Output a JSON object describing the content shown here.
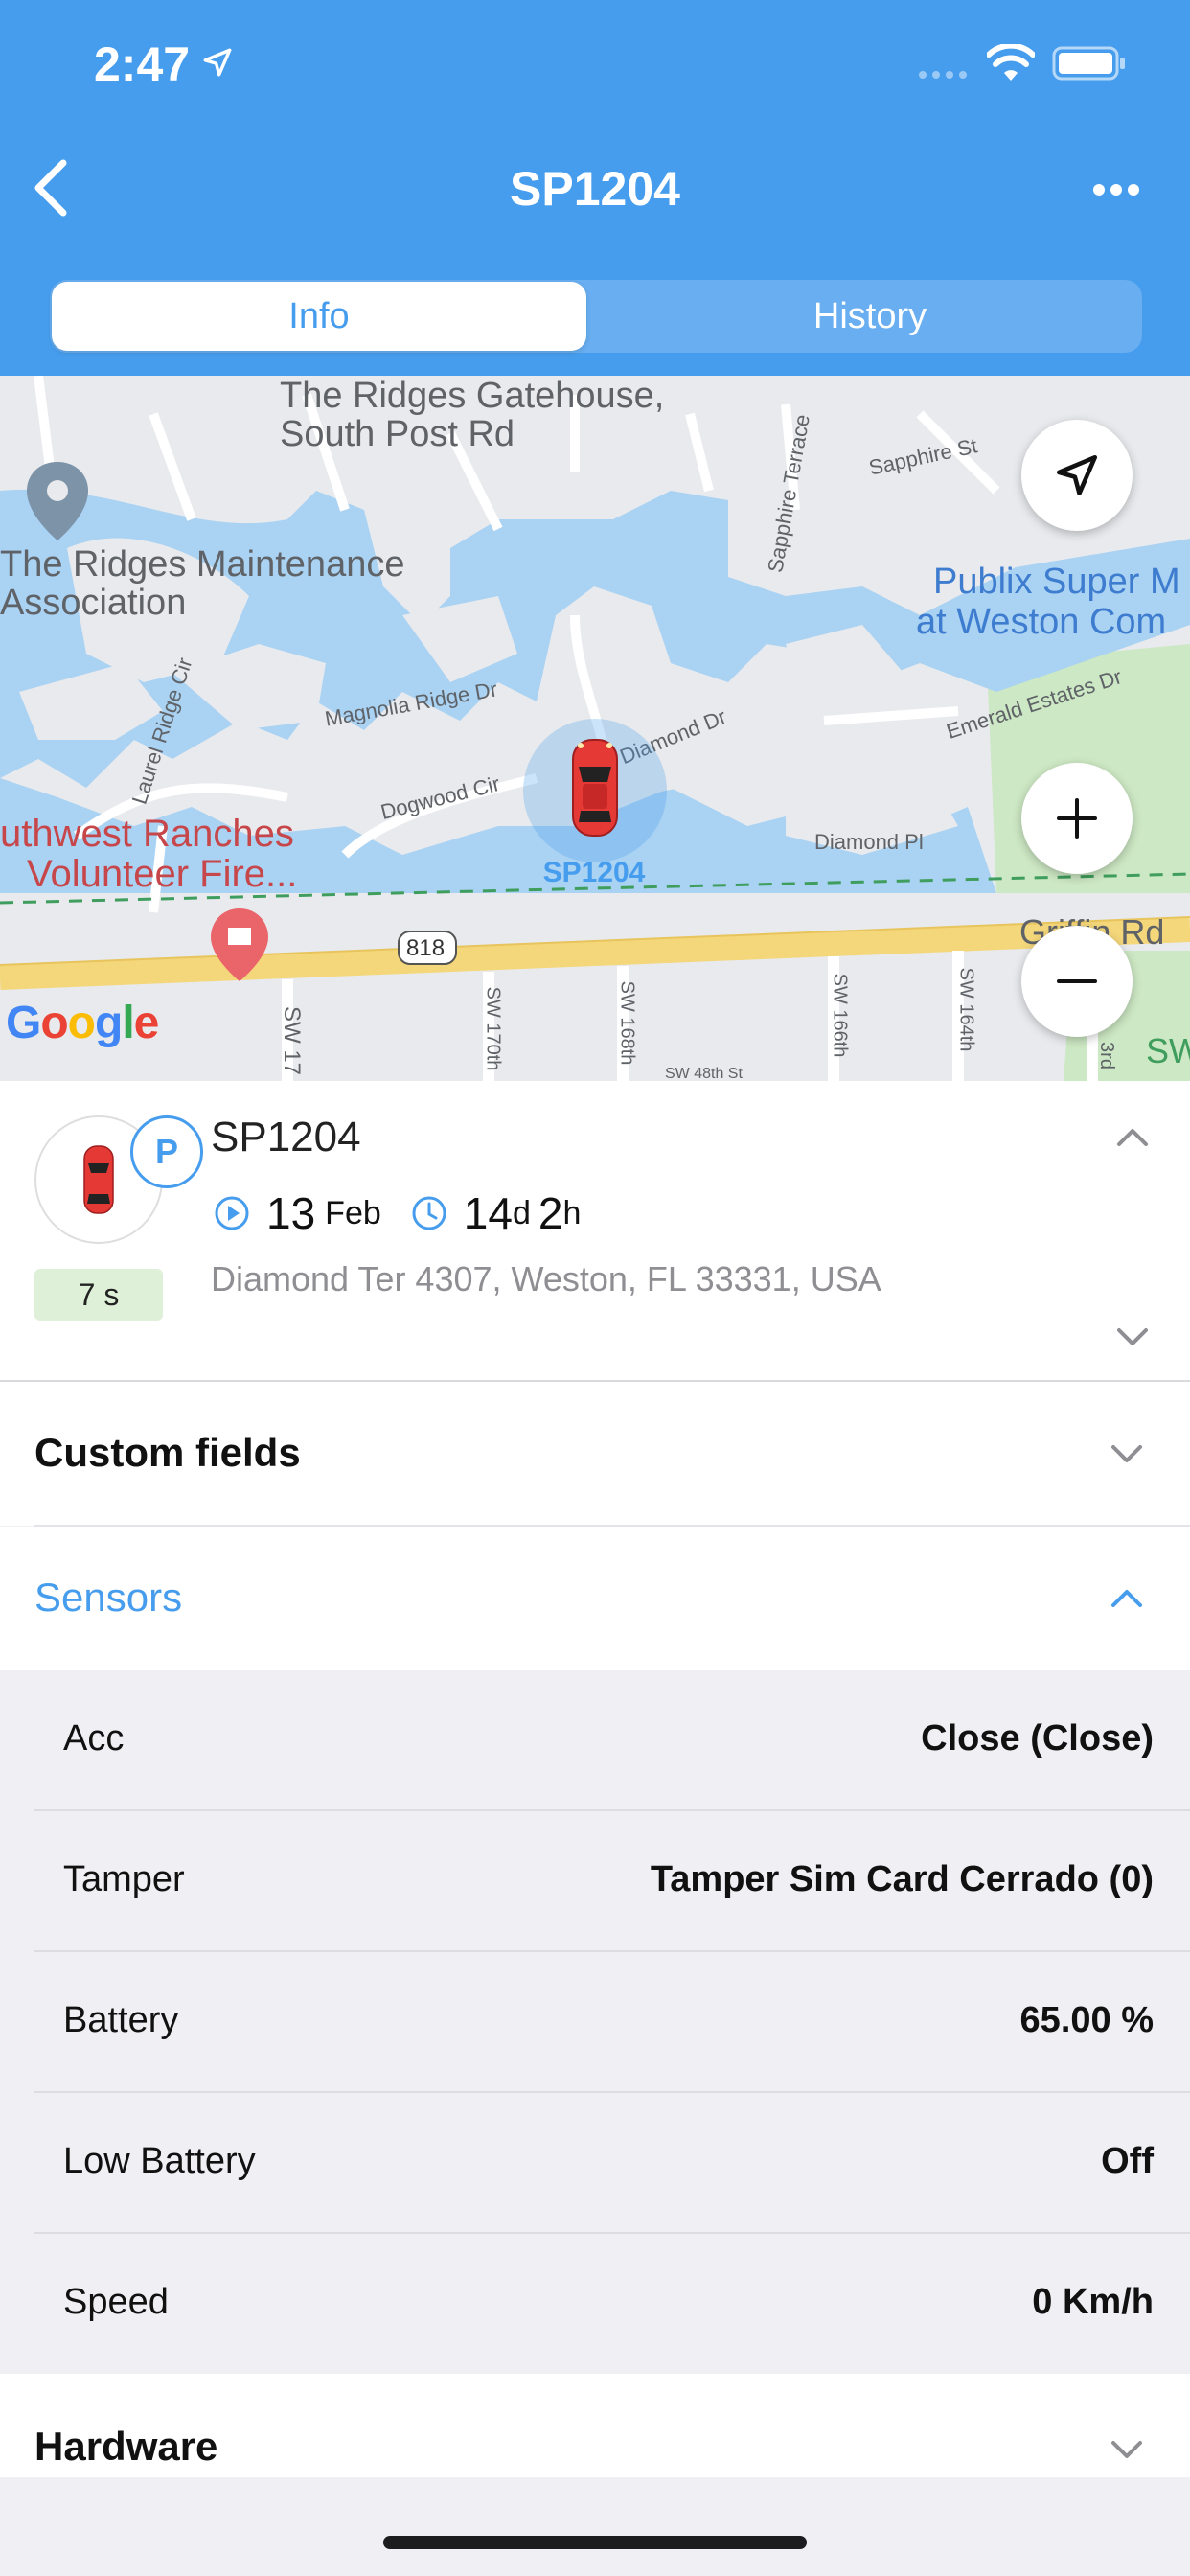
{
  "status_bar": {
    "time": "2:47"
  },
  "nav": {
    "title": "SP1204",
    "tabs": [
      {
        "label": "Info",
        "active": true
      },
      {
        "label": "History",
        "active": false
      }
    ]
  },
  "map": {
    "labels": {
      "gatehouse_1": "The Ridges Gatehouse,",
      "gatehouse_2": "South Post Rd",
      "maint_1": "The Ridges Maintenance",
      "maint_2": "Association",
      "publix_1": "Publix Super M",
      "publix_2": "at Weston Com",
      "fire_1": "uthwest Ranches",
      "fire_2": "Volunteer Fire...",
      "sapphire_st": "Sapphire St",
      "sapphire_terrace": "Sapphire Terrace",
      "magnolia": "Magnolia Ridge Dr",
      "laurel": "Laurel Ridge Cir",
      "dogwood": "Dogwood Cir",
      "diamond_dr": "Diamond Dr",
      "diamond_pl": "Diamond Pl",
      "emerald": "Emerald Estates Dr",
      "griffin": "Griffin Rd",
      "route": "818",
      "sw172": "SW 17",
      "sw170": "SW 170th",
      "sw168": "SW 168th",
      "sw166": "SW 166th",
      "sw164": "SW 164th",
      "sw48": "SW 48th St",
      "sw_right": "SW",
      "sw3rd": "3rd"
    },
    "marker_label": "SP1204",
    "attribution": "Google",
    "controls": {
      "locate": "navigate-icon",
      "zoom_in": "plus-icon",
      "zoom_out": "minus-icon"
    }
  },
  "device": {
    "name": "SP1204",
    "status_badge": "P",
    "age": "7 s",
    "date_day": "13",
    "date_month": "Feb",
    "duration_days": "14",
    "duration_days_unit": "d",
    "duration_hours": "2",
    "duration_hours_unit": "h",
    "address": "Diamond Ter 4307, Weston, FL 33331, USA"
  },
  "sections": {
    "custom_fields": "Custom fields",
    "sensors": "Sensors",
    "hardware": "Hardware"
  },
  "sensors": [
    {
      "name": "Acc",
      "value": "Close (Close)"
    },
    {
      "name": "Tamper",
      "value": "Tamper Sim Card Cerrado (0)"
    },
    {
      "name": "Battery",
      "value": "65.00 %"
    },
    {
      "name": "Low Battery",
      "value": "Off"
    },
    {
      "name": "Speed",
      "value": "0 Km/h"
    }
  ],
  "colors": {
    "accent": "#479ded",
    "header_bg": "#479ded",
    "age_badge_bg": "#dff0d8",
    "car": "#e53935"
  }
}
